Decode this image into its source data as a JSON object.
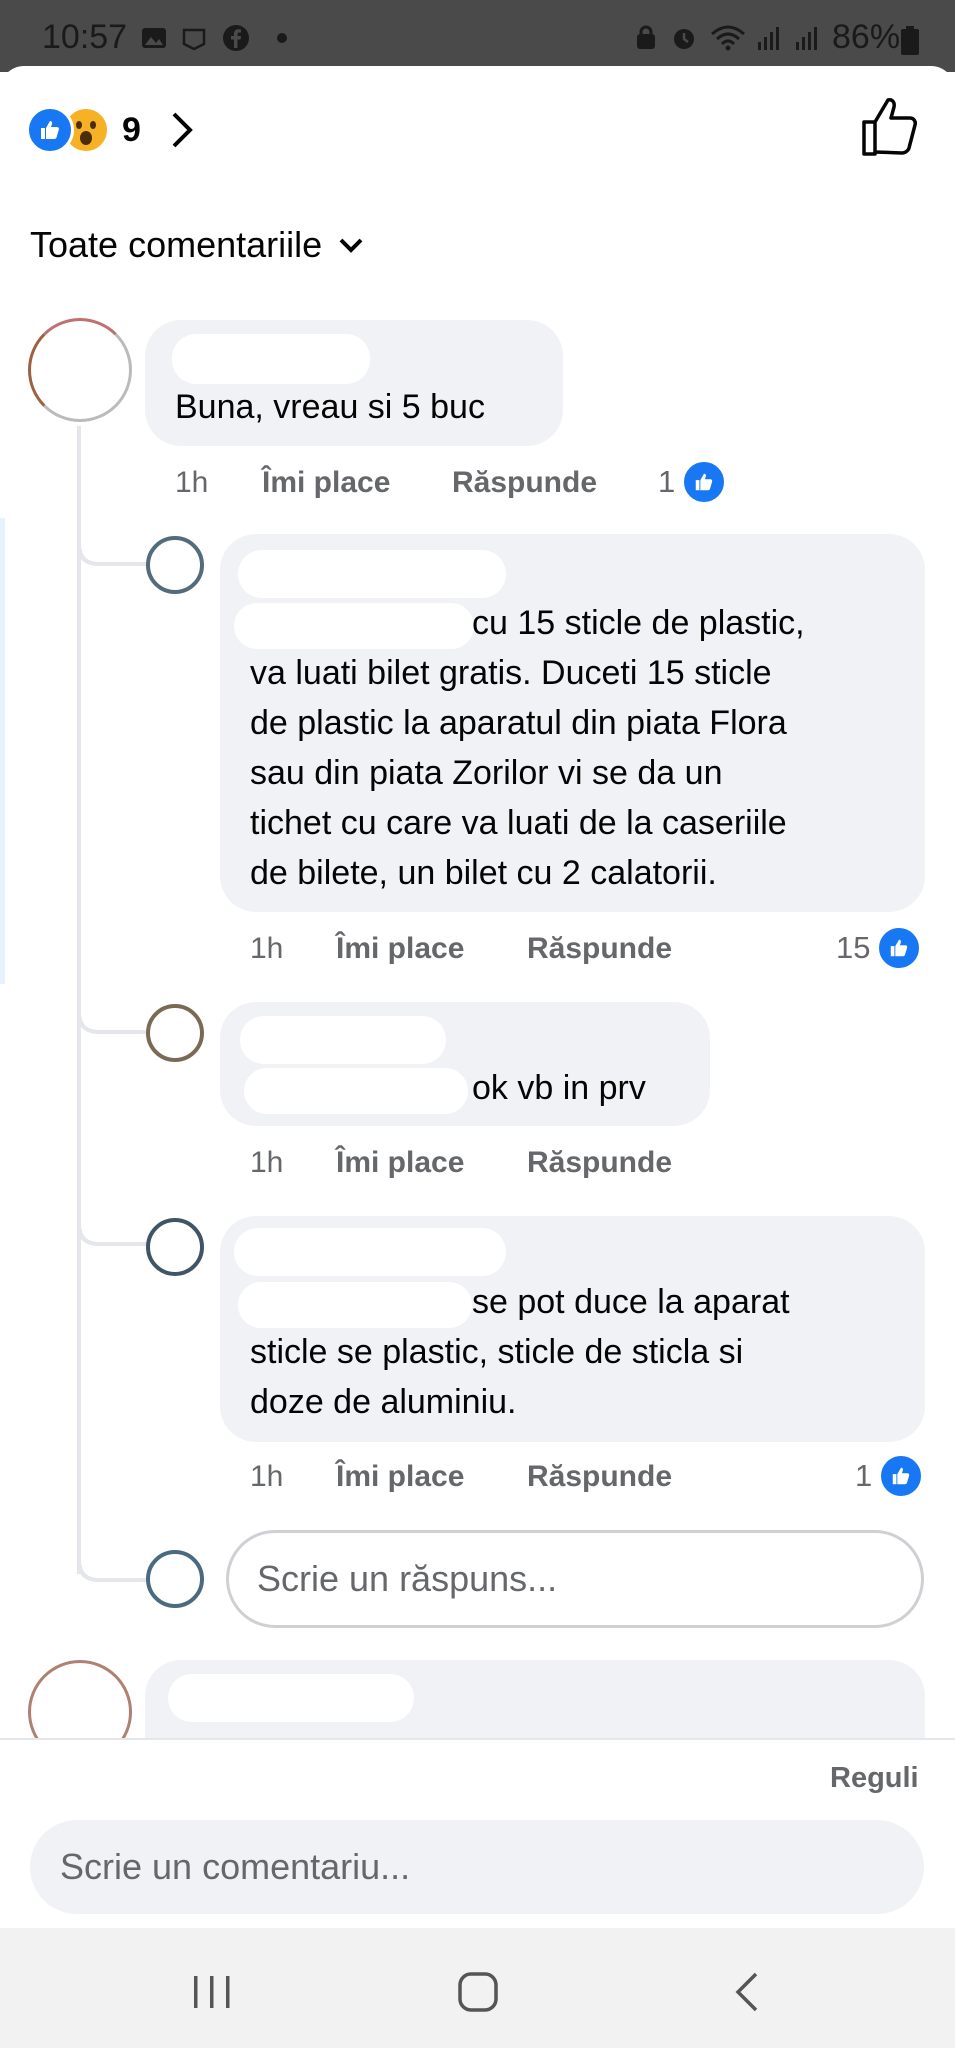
{
  "status_bar": {
    "time": "10:57",
    "battery": "86%"
  },
  "reactions": {
    "count": "9"
  },
  "filter": {
    "label": "Toate comentariile"
  },
  "comments": [
    {
      "text": "Buna, vreau si 5 buc",
      "time": "1h",
      "like": "Îmi place",
      "reply": "Răspunde",
      "reactions": "1"
    }
  ],
  "replies": [
    {
      "lines": [
        "cu 15 sticle de plastic,",
        "va luati bilet gratis. Duceti 15 sticle",
        "de plastic la aparatul din piata Flora",
        "sau din piata Zorilor  vi se da un",
        "tichet cu care va luati de la caseriile",
        "de bilete, un bilet cu 2 calatorii."
      ],
      "time": "1h",
      "like": "Îmi place",
      "reply": "Răspunde",
      "reactions": "15"
    },
    {
      "lines": [
        "ok vb in prv"
      ],
      "time": "1h",
      "like": "Îmi place",
      "reply": "Răspunde"
    },
    {
      "lines": [
        "se pot duce la aparat",
        "sticle se plastic, sticle de sticla si",
        "doze de aluminiu."
      ],
      "time": "1h",
      "like": "Îmi place",
      "reply": "Răspunde",
      "reactions": "1"
    }
  ],
  "reply_input": {
    "placeholder": "Scrie un răspuns..."
  },
  "footer": {
    "rules": "Reguli",
    "comment_placeholder": "Scrie un comentariu..."
  },
  "colors": {
    "accent": "#1877f2",
    "bubble": "#f0f2f5",
    "muted": "#65676b"
  }
}
